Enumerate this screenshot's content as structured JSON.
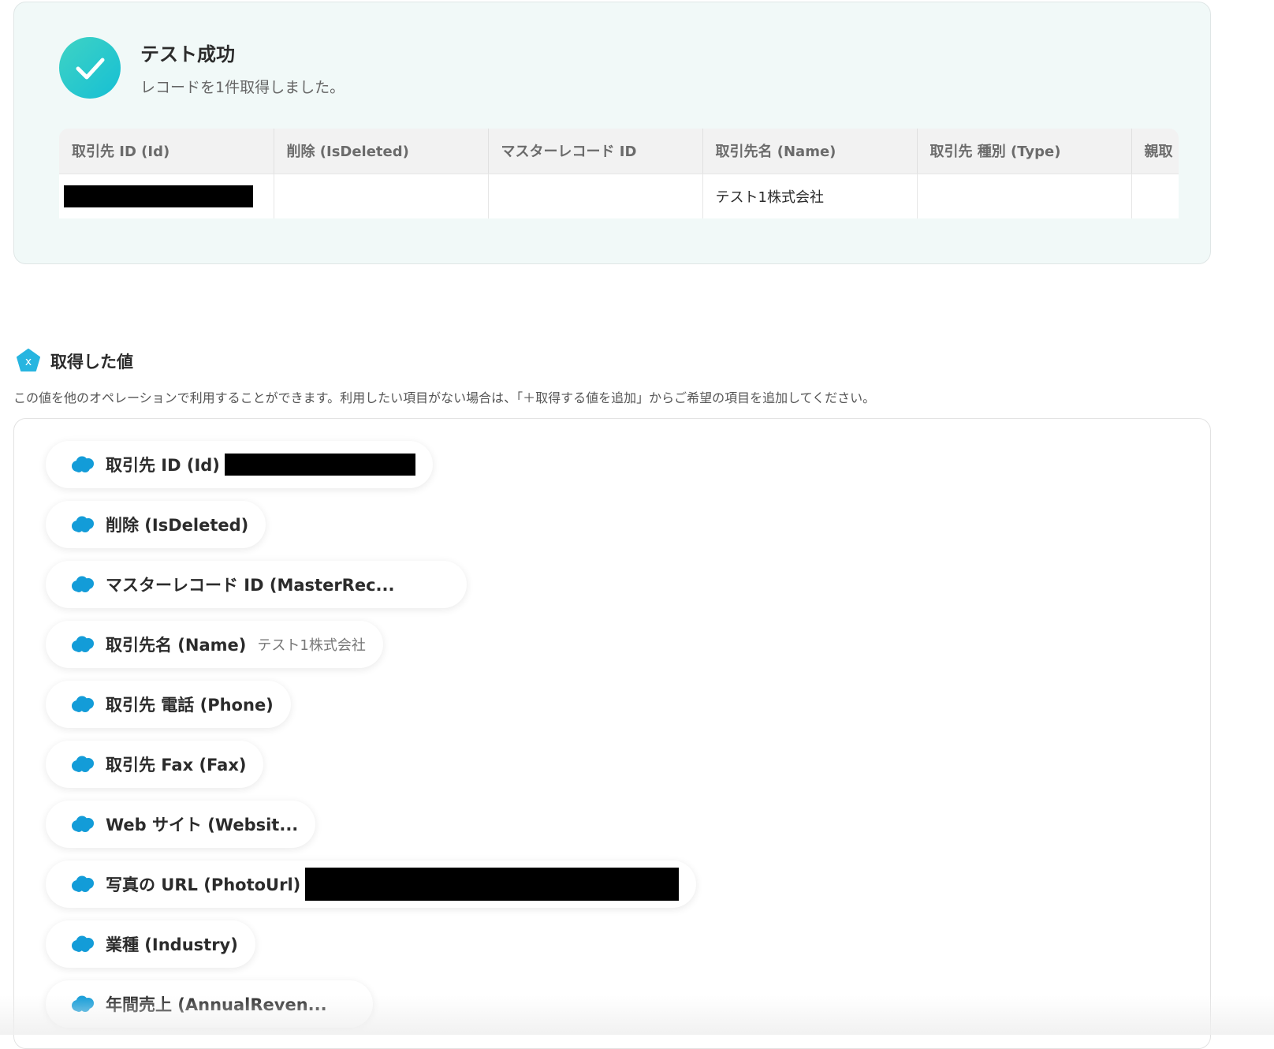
{
  "result": {
    "title": "テスト成功",
    "subtitle": "レコードを1件取得しました。",
    "table": {
      "columns": [
        "取引先 ID (Id)",
        "削除 (IsDeleted)",
        "マスターレコード ID",
        "取引先名 (Name)",
        "取引先 種別 (Type)",
        "親取"
      ],
      "row": [
        "",
        "",
        "",
        "テスト1株式会社",
        "",
        ""
      ]
    }
  },
  "values": {
    "title": "取得した値",
    "description": "この値を他のオペレーションで利用することができます。利用したい項目がない場合は、「＋取得する値を追加」からご希望の項目を追加してください。",
    "items": [
      {
        "label": "取引先 ID (Id)",
        "value": ""
      },
      {
        "label": "削除 (IsDeleted)",
        "value": ""
      },
      {
        "label": "マスターレコード ID (MasterRec...",
        "value": ""
      },
      {
        "label": "取引先名 (Name)",
        "value": "テスト1株式会社"
      },
      {
        "label": "取引先 電話 (Phone)",
        "value": ""
      },
      {
        "label": "取引先 Fax (Fax)",
        "value": ""
      },
      {
        "label": "Web サイト (Websit...",
        "value": ""
      },
      {
        "label": "写真の URL (PhotoUrl)",
        "value": ""
      },
      {
        "label": "業種 (Industry)",
        "value": ""
      },
      {
        "label": "年間売上 (AnnualReven...",
        "value": ""
      }
    ]
  },
  "colors": {
    "success_gradient_start": "#3fd3c4",
    "success_gradient_end": "#16bfd4",
    "card_background": "#f1f9f8",
    "salesforce_blue": "#139cd8",
    "values_icon": "#27b5e0"
  },
  "icons": {
    "success": "checkmark-icon",
    "values": "variable-x-icon",
    "item": "salesforce-cloud-icon"
  }
}
